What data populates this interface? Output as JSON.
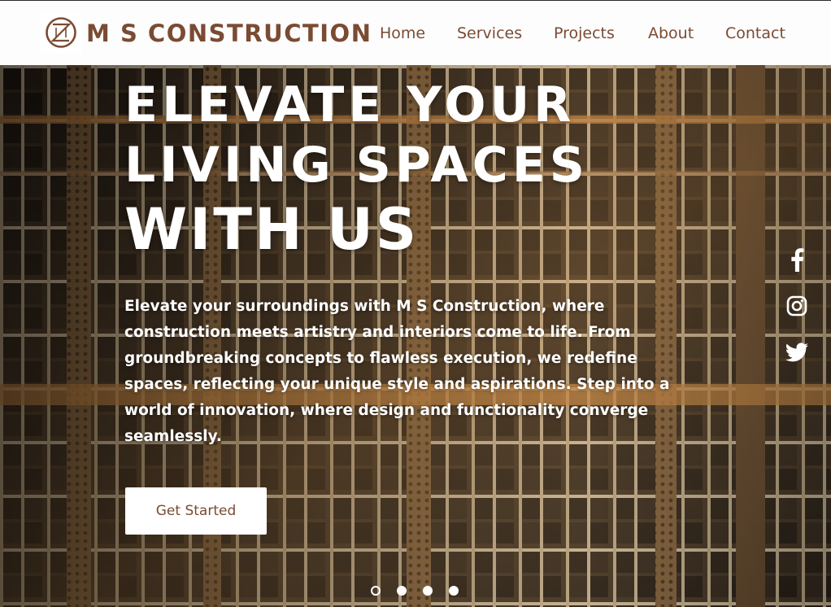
{
  "brand": {
    "name": "M S CONSTRUCTION",
    "color": "#7a4b33"
  },
  "nav": [
    {
      "label": "Home"
    },
    {
      "label": "Services"
    },
    {
      "label": "Projects"
    },
    {
      "label": "About"
    },
    {
      "label": "Contact"
    }
  ],
  "hero": {
    "title_line1": "ELEVATE YOUR",
    "title_line2": "LIVING SPACES",
    "title_line3": "WITH US",
    "description": "Elevate your surroundings with M S Construction, where construction meets artistry and interiors come to life. From groundbreaking concepts to flawless execution, we redefine spaces, reflecting your unique style and aspirations. Step into a world of innovation, where design and functionality converge seamlessly.",
    "cta_label": "Get Started"
  },
  "social": [
    {
      "icon": "facebook-icon"
    },
    {
      "icon": "instagram-icon"
    },
    {
      "icon": "twitter-icon"
    }
  ],
  "slider": {
    "count": 4,
    "active_index": 0
  }
}
